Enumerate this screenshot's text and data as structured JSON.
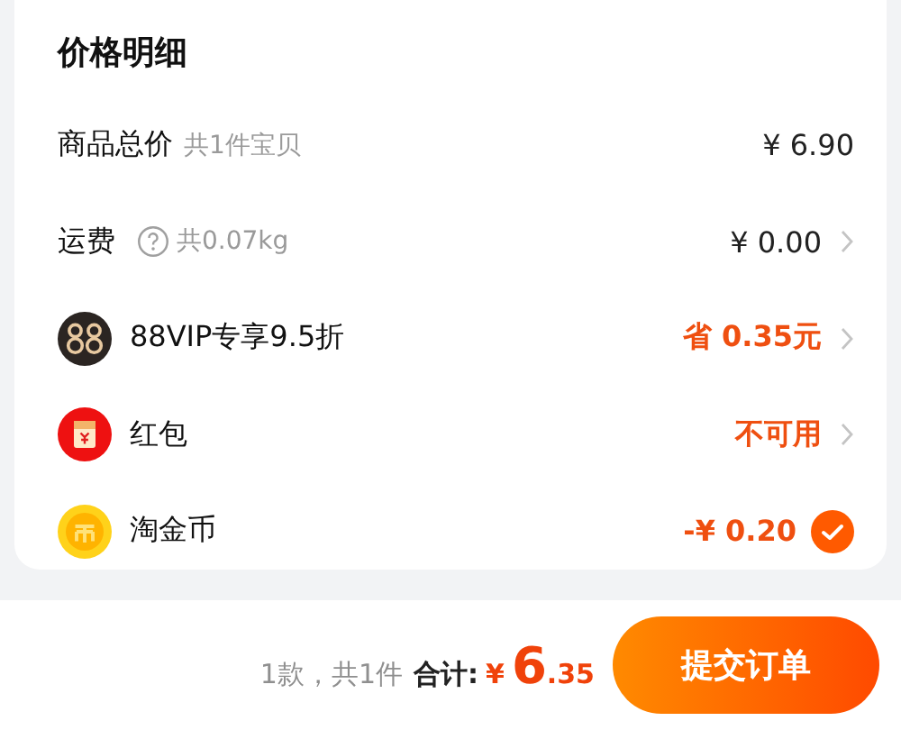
{
  "panel": {
    "title": "价格明细",
    "rows": [
      {
        "kind": "subtotal",
        "label": "商品总价",
        "note": "共1件宝贝",
        "value": "¥ 6.90",
        "emphasis": false
      },
      {
        "kind": "shipping",
        "label": "运费",
        "note": "共0.07kg",
        "value": "¥ 0.00",
        "emphasis": false
      },
      {
        "kind": "membership",
        "label": "88VIP专享9.5折",
        "value": "省 0.35元",
        "emphasis": true
      },
      {
        "kind": "voucher",
        "label": "红包",
        "value": "不可用",
        "emphasis": true
      },
      {
        "kind": "coins",
        "label": "淘金币",
        "value": "-¥ 0.20",
        "emphasis": true,
        "checked": true
      }
    ]
  },
  "footer": {
    "count": "1款，共1件",
    "total_label": "合计:",
    "currency": "¥",
    "total_int": "6",
    "total_dec": ".35",
    "submit": "提交订单"
  }
}
